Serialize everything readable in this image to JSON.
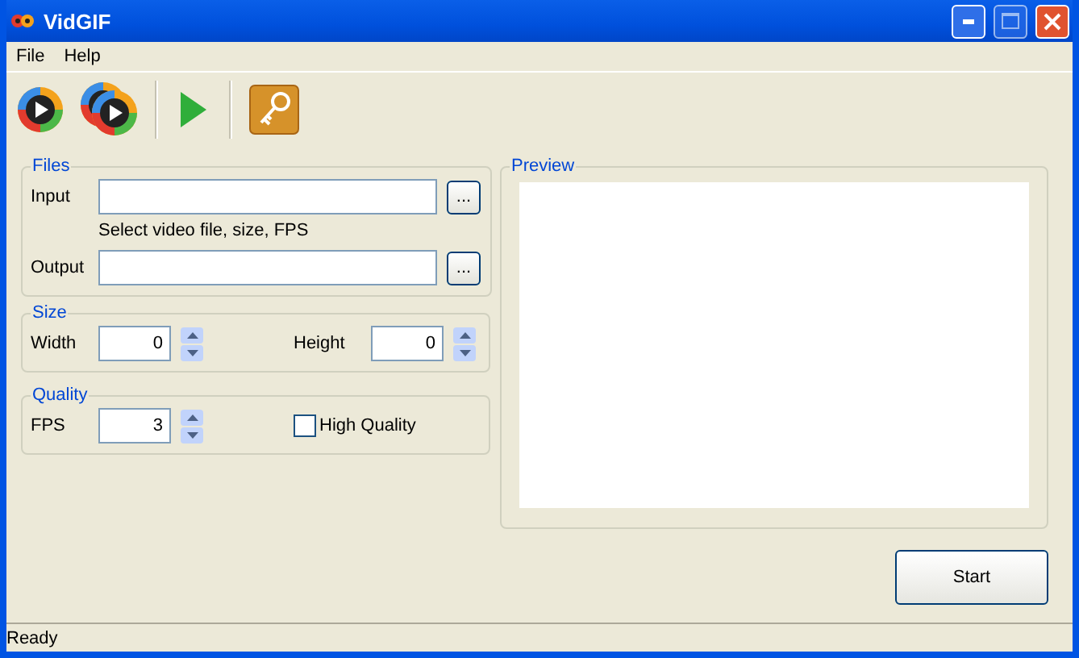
{
  "window": {
    "title": "VidGIF"
  },
  "menu": [
    {
      "label": "File"
    },
    {
      "label": "Help"
    }
  ],
  "files": {
    "title": "Files",
    "input_label": "Input",
    "hint": "Select video file, size, FPS",
    "output_label": "Output",
    "browse_input": "...",
    "browse_output": "..."
  },
  "size": {
    "title": "Size",
    "width_label": "Width",
    "width_value": "0",
    "height_label": "Height",
    "height_value": "0"
  },
  "quality": {
    "title": "Quality",
    "fps_label": "FPS",
    "fps_value": "3",
    "high_quality_label": "High Quality",
    "high_quality_checked": false
  },
  "preview": {
    "title": "Preview"
  },
  "start_button": "Start",
  "status_bar": "Ready"
}
